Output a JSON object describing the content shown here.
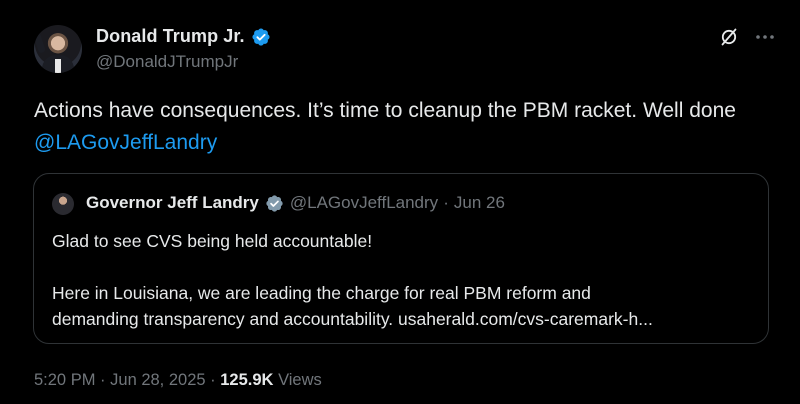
{
  "author": {
    "name": "Donald Trump Jr.",
    "handle": "@DonaldJTrumpJr"
  },
  "tweet": {
    "text_before_mention": "Actions have consequences. It’s time to cleanup the PBM racket. Well done ",
    "mention": "@LAGovJeffLandry"
  },
  "quoted": {
    "name": "Governor Jeff Landry",
    "handle": "@LAGovJeffLandry",
    "separator": "·",
    "date": "Jun 26",
    "line1": "Glad to see CVS being held accountable!",
    "line2": "Here in Louisiana, we are leading the charge for real PBM reform and",
    "line3": "demanding transparency and accountability. usaherald.com/cvs-caremark-h..."
  },
  "footer": {
    "time": "5:20 PM",
    "separator": "·",
    "date": "Jun 28, 2025",
    "separator2": "·",
    "views_count": "125.9K",
    "views_label": "Views"
  },
  "icons": {
    "verified": "verified-badge-icon",
    "grok": "grok-icon",
    "more": "more-icon"
  },
  "colors": {
    "background": "#000000",
    "text": "#e7e9ea",
    "secondary": "#71767b",
    "link": "#1d9bf0",
    "verified": "#1d9bf0",
    "border": "#2f3336"
  }
}
